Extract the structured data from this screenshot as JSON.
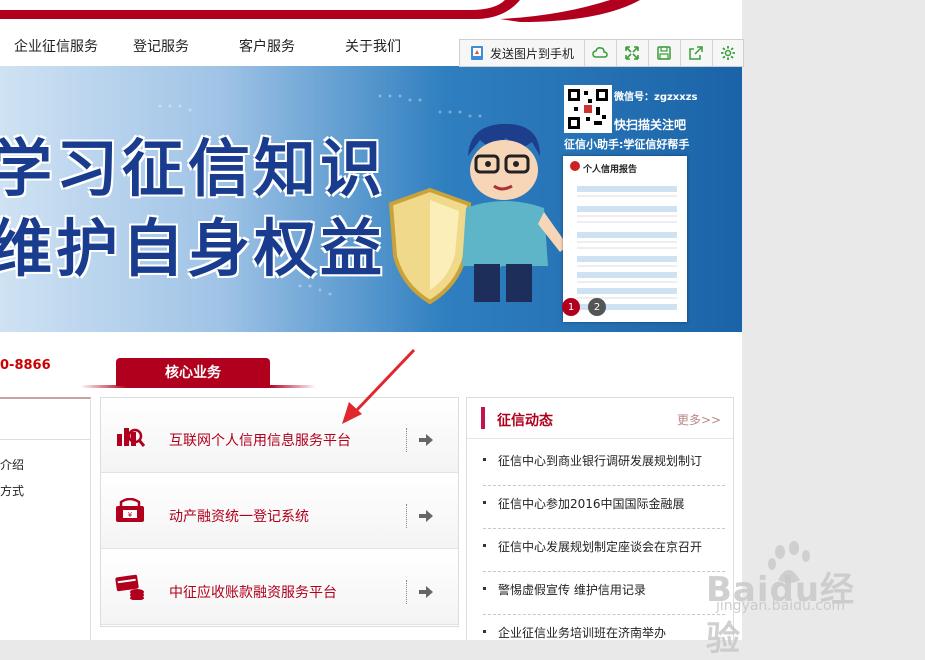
{
  "nav": {
    "items": [
      {
        "label": "企业征信服务"
      },
      {
        "label": "登记服务"
      },
      {
        "label": "客户服务"
      },
      {
        "label": "关于我们"
      }
    ]
  },
  "toolbar": {
    "send_label": "发送图片到手机",
    "icons": [
      "cloud-icon",
      "expand-icon",
      "save-icon",
      "share-icon",
      "settings-icon"
    ]
  },
  "banner": {
    "line1": "学习征信知识",
    "line2": "维护自身权益",
    "wechat": "微信号：zgzxxzs",
    "scan": "快扫描关注吧",
    "assistant": "征信小助手:学征信好帮手",
    "report_title": "个人信用报告",
    "report_rows": [
      "一 个人信息",
      "二 信息概要",
      "三 信贷交易信息明细",
      "四 公共信息明细",
      "五 本人声明",
      "六 异议标注",
      "七 查询记录"
    ],
    "slides": [
      "1",
      "2"
    ]
  },
  "phone": "0-8866",
  "core": {
    "tab_label": "核心业务",
    "items": [
      {
        "label": "互联网个人信用信息服务平台",
        "icon": "chart-search-icon"
      },
      {
        "label": "动产融资统一登记系统",
        "icon": "registry-icon"
      },
      {
        "label": "中征应收账款融资服务平台",
        "icon": "receivables-icon"
      }
    ]
  },
  "left": {
    "links": [
      "介绍",
      "方式"
    ]
  },
  "news": {
    "title": "征信动态",
    "more": "更多>>",
    "items": [
      "征信中心到商业银行调研发展规划制订",
      "征信中心参加2016中国国际金融展",
      "征信中心发展规划制定座谈会在京召开",
      "警惕虚假宣传 维护信用记录",
      "企业征信业务培训班在济南举办"
    ]
  },
  "watermark": {
    "logo": "Baidu经验",
    "sub": "jingyan.baidu.com"
  },
  "colors": {
    "brand_red": "#b0001d",
    "banner_blue": "#1b63a8"
  }
}
